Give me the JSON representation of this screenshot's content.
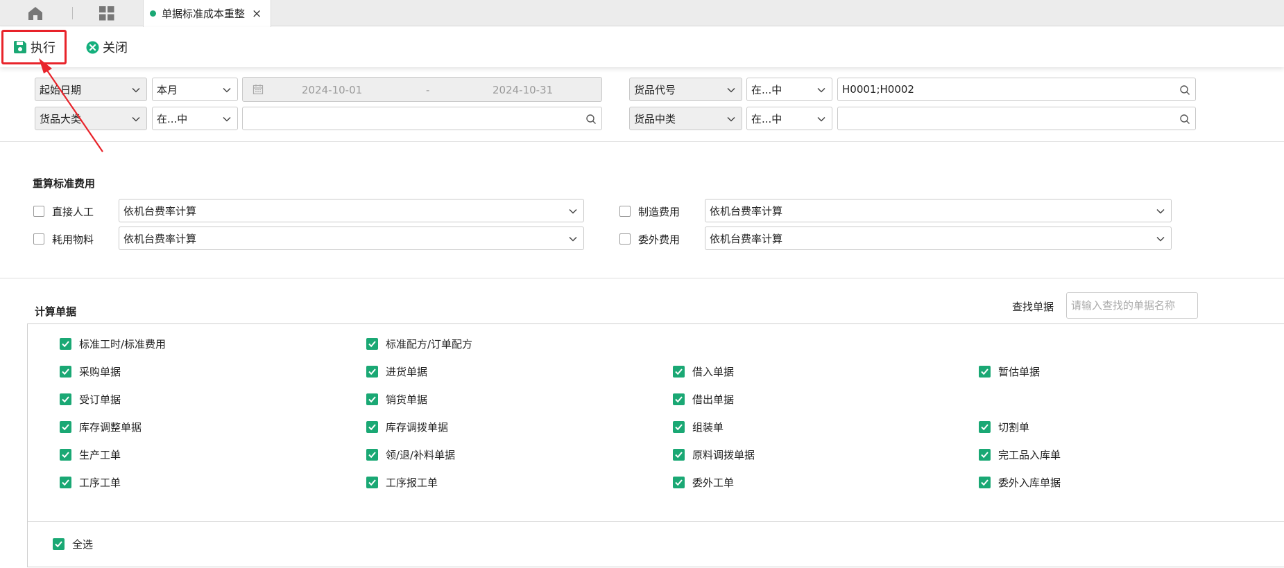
{
  "tab": {
    "title": "单据标准成本重整",
    "close_glyph": "×"
  },
  "colors": {
    "accent": "#1aa874",
    "highlight": "#e8232a",
    "close_icon": "#15b07d",
    "save_icon": "#1aa874"
  },
  "toolbar": {
    "execute": "执行",
    "close": "关闭"
  },
  "filters": {
    "date_field": "起始日期",
    "date_period": "本月",
    "date_from": "2024-10-01",
    "date_sep": "-",
    "date_to": "2024-10-31",
    "category_field": "货品大类",
    "category_op": "在...中",
    "category_value": "",
    "product_field": "货品代号",
    "product_op": "在...中",
    "product_value": "H0001;H0002",
    "subcategory_field": "货品中类",
    "subcategory_op": "在...中",
    "subcategory_value": ""
  },
  "recalc": {
    "title": "重算标准费用",
    "items": [
      {
        "label": "直接人工",
        "checked": false,
        "method": "依机台费率计算"
      },
      {
        "label": "制造费用",
        "checked": false,
        "method": "依机台费率计算"
      },
      {
        "label": "耗用物料",
        "checked": false,
        "method": "依机台费率计算"
      },
      {
        "label": "委外费用",
        "checked": false,
        "method": "依机台费率计算"
      }
    ]
  },
  "docs": {
    "title": "计算单据",
    "search_label": "查找单据",
    "search_placeholder": "请输入查找的单据名称",
    "items": [
      {
        "label": "标准工时/标准费用",
        "checked": true
      },
      {
        "label": "标准配方/订单配方",
        "checked": true
      },
      {
        "label": "采购单据",
        "checked": true
      },
      {
        "label": "进货单据",
        "checked": true
      },
      {
        "label": "借入单据",
        "checked": true
      },
      {
        "label": "暂估单据",
        "checked": true
      },
      {
        "label": "受订单据",
        "checked": true
      },
      {
        "label": "销货单据",
        "checked": true
      },
      {
        "label": "借出单据",
        "checked": true
      },
      {
        "label": "库存调整单据",
        "checked": true
      },
      {
        "label": "库存调拨单据",
        "checked": true
      },
      {
        "label": "组装单",
        "checked": true
      },
      {
        "label": "切割单",
        "checked": true
      },
      {
        "label": "生产工单",
        "checked": true
      },
      {
        "label": "领/退/补料单据",
        "checked": true
      },
      {
        "label": "原料调拨单据",
        "checked": true
      },
      {
        "label": "完工品入库单",
        "checked": true
      },
      {
        "label": "工序工单",
        "checked": true
      },
      {
        "label": "工序报工单",
        "checked": true
      },
      {
        "label": "委外工单",
        "checked": true
      },
      {
        "label": "委外入库单据",
        "checked": true
      }
    ],
    "select_all": "全选",
    "select_all_checked": true
  }
}
